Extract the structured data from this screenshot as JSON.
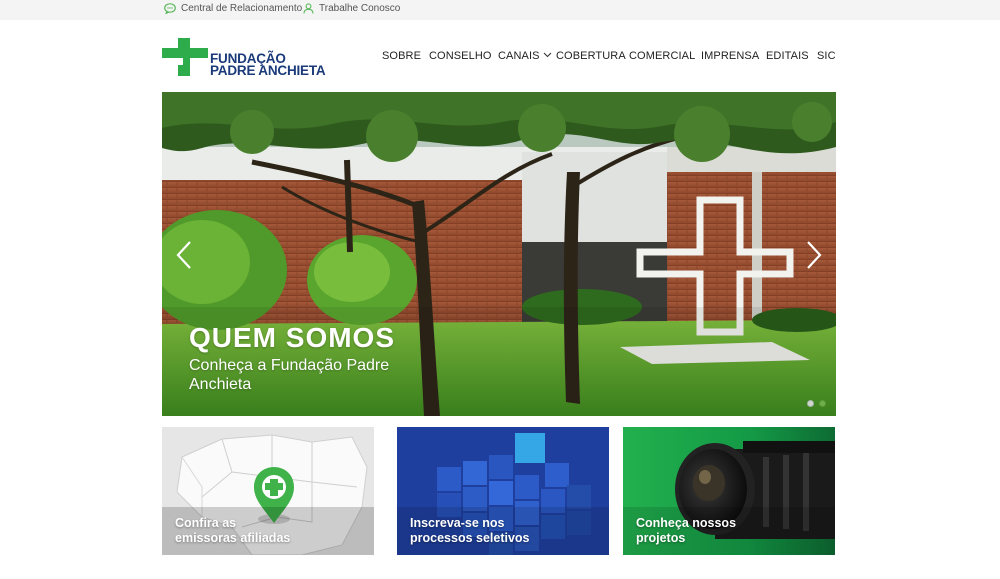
{
  "topbar": {
    "links": [
      {
        "label": "Central de Relacionamento",
        "icon": "chat-icon"
      },
      {
        "label": "Trabalhe Conosco",
        "icon": "user-icon"
      }
    ],
    "icon_color": "#5cb85c"
  },
  "logo": {
    "line1": "FUNDAÇÃO",
    "line2": "PADRE ANCHIETA",
    "brand_green": "#2eab4b",
    "brand_blue": "#1b3a7a"
  },
  "nav": {
    "items": [
      {
        "label": "SOBRE"
      },
      {
        "label": "CONSELHO"
      },
      {
        "label": "CANAIS",
        "has_dropdown": true
      },
      {
        "label": "COBERTURA"
      },
      {
        "label": "COMERCIAL"
      },
      {
        "label": "IMPRENSA"
      },
      {
        "label": "EDITAIS"
      },
      {
        "label": "SIC"
      }
    ]
  },
  "hero": {
    "title": "QUEM SOMOS",
    "subtitle": "Conheça a Fundação Padre Anchieta",
    "prev_icon": "chevron-left-icon",
    "next_icon": "chevron-right-icon",
    "slide_count": 2,
    "active_slide": 2
  },
  "cards": [
    {
      "label_line1": "Confira as",
      "label_line2": "emissoras afiliadas",
      "bg": "#e8e8e8"
    },
    {
      "label_line1": "Inscreva-se nos",
      "label_line2": "processos seletivos",
      "bg": "#1e3f9e"
    },
    {
      "label_line1": "Conheça nossos",
      "label_line2": "projetos",
      "bg": "#18a85a"
    }
  ]
}
